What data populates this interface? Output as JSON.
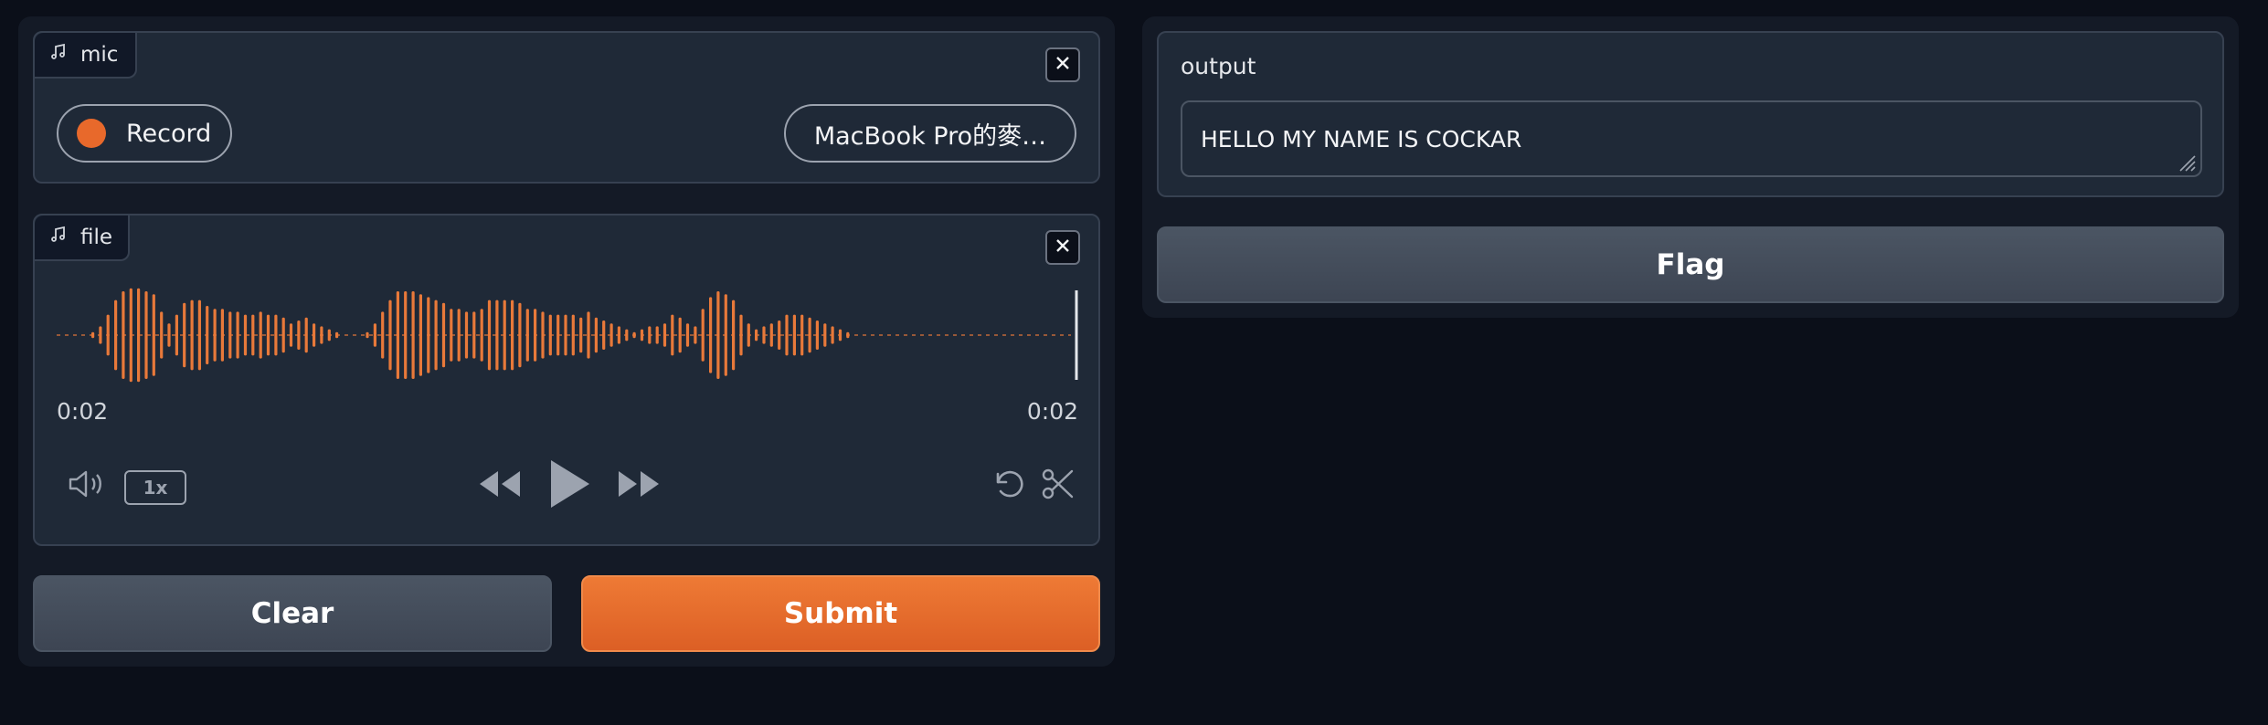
{
  "colors": {
    "accent": "#e8692b",
    "background": "#0b0f19",
    "panel": "#1f2937",
    "waveform": "#e8793a"
  },
  "mic": {
    "label": "mic",
    "label_icon": "music-note-icon",
    "record_label": "Record",
    "device_label": "MacBook Pro的麥…"
  },
  "file": {
    "label": "file",
    "label_icon": "music-note-icon",
    "current_time": "0:02",
    "duration": "0:02",
    "playback_speed": "1x",
    "playback_progress": 1.0
  },
  "actions": {
    "clear_label": "Clear",
    "submit_label": "Submit"
  },
  "output": {
    "label": "output",
    "value": "HELLO MY NAME IS COCKAR",
    "flag_label": "Flag"
  }
}
